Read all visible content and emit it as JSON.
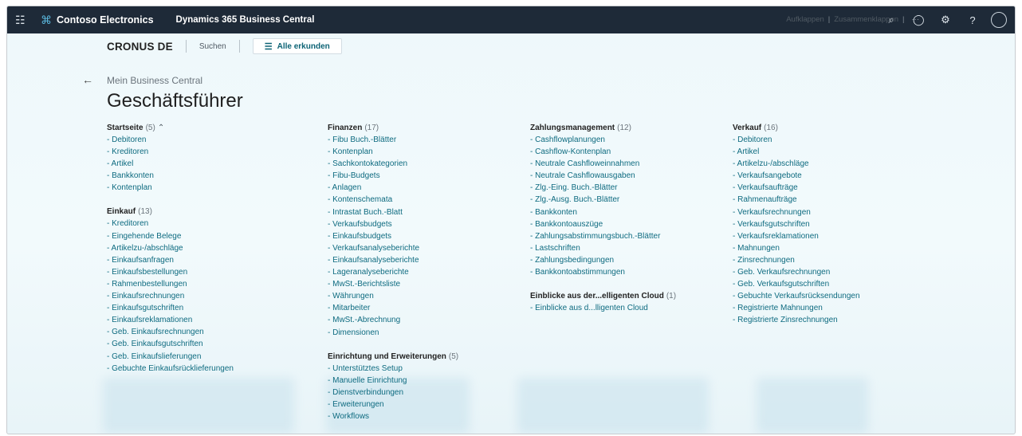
{
  "topbar": {
    "company": "Contoso Electronics",
    "product": "Dynamics 365 Business Central",
    "icons": [
      "waffle-icon",
      "search-icon",
      "bell-icon",
      "gear-icon",
      "help-icon",
      "avatar"
    ]
  },
  "navbar": {
    "company": "CRONUS DE",
    "search": "Suchen",
    "explore": "Alle erkunden",
    "expand": "Aufklappen",
    "separator": "|",
    "collapse": "Zusammenklappen",
    "more": "···"
  },
  "page": {
    "breadcrumb": "Mein Business Central",
    "title": "Geschäftsführer"
  },
  "columns": [
    [
      {
        "title": "Startseite",
        "count": "(5)",
        "items": [
          "- Debitoren",
          "- Kreditoren",
          "- Artikel",
          "- Bankkonten",
          "- Kontenplan"
        ]
      },
      {
        "title": "Einkauf",
        "count": "(13)",
        "items": [
          "- Kreditoren",
          "- Eingehende Belege",
          "- Artikelzu-/abschläge",
          "- Einkaufsanfragen",
          "- Einkaufsbestellungen",
          "- Rahmenbestellungen",
          "- Einkaufsrechnungen",
          "- Einkaufsgutschriften",
          "- Einkaufsreklamationen",
          "- Geb. Einkaufsrechnungen",
          "- Geb. Einkaufsgutschriften",
          "- Geb. Einkaufslieferungen",
          "- Gebuchte Einkaufsrücklieferungen"
        ]
      }
    ],
    [
      {
        "title": "Finanzen",
        "count": "(17)",
        "items": [
          "- Fibu Buch.-Blätter",
          "- Kontenplan",
          "- Sachkontokategorien",
          "- Fibu-Budgets",
          "- Anlagen",
          "- Kontenschemata",
          "- Intrastat Buch.-Blatt",
          "- Verkaufsbudgets",
          "- Einkaufsbudgets",
          "- Verkaufsanalyseberichte",
          "- Einkaufsanalyseberichte",
          "- Lageranalyseberichte",
          "- MwSt.-Berichtsliste",
          "- Währungen",
          "- Mitarbeiter",
          "- MwSt.-Abrechnung",
          "- Dimensionen"
        ]
      },
      {
        "title": "Einrichtung und Erweiterungen",
        "count": "(5)",
        "items": [
          "- Unterstütztes Setup",
          "- Manuelle Einrichtung",
          "- Dienstverbindungen",
          "- Erweiterungen",
          "- Workflows"
        ]
      }
    ],
    [
      {
        "title": "Zahlungsmanagement",
        "count": "(12)",
        "items": [
          "- Cashflowplanungen",
          "- Cashflow-Kontenplan",
          "- Neutrale Cashfloweinnahmen",
          "- Neutrale Cashflowausgaben",
          "- Zlg.-Eing. Buch.-Blätter",
          "- Zlg.-Ausg. Buch.-Blätter",
          "- Bankkonten",
          "- Bankkontoauszüge",
          "- Zahlungsabstimmungsbuch.-Blätter",
          "- Lastschriften",
          "- Zahlungsbedingungen",
          "- Bankkontoabstimmungen"
        ]
      },
      {
        "title": "Einblicke aus der...elligenten Cloud",
        "count": "(1)",
        "items": [
          "- Einblicke aus d...lligenten Cloud"
        ]
      }
    ],
    [
      {
        "title": "Verkauf",
        "count": "(16)",
        "items": [
          "- Debitoren",
          "- Artikel",
          "- Artikelzu-/abschläge",
          "- Verkaufsangebote",
          "- Verkaufsaufträge",
          "- Rahmenaufträge",
          "- Verkaufsrechnungen",
          "- Verkaufsgutschriften",
          "- Verkaufsreklamationen",
          "- Mahnungen",
          "- Zinsrechnungen",
          "- Geb. Verkaufsrechnungen",
          "- Geb. Verkaufsgutschriften",
          "- Gebuchte Verkaufsrücksendungen",
          "- Registrierte Mahnungen",
          "- Registrierte Zinsrechnungen"
        ]
      }
    ]
  ]
}
